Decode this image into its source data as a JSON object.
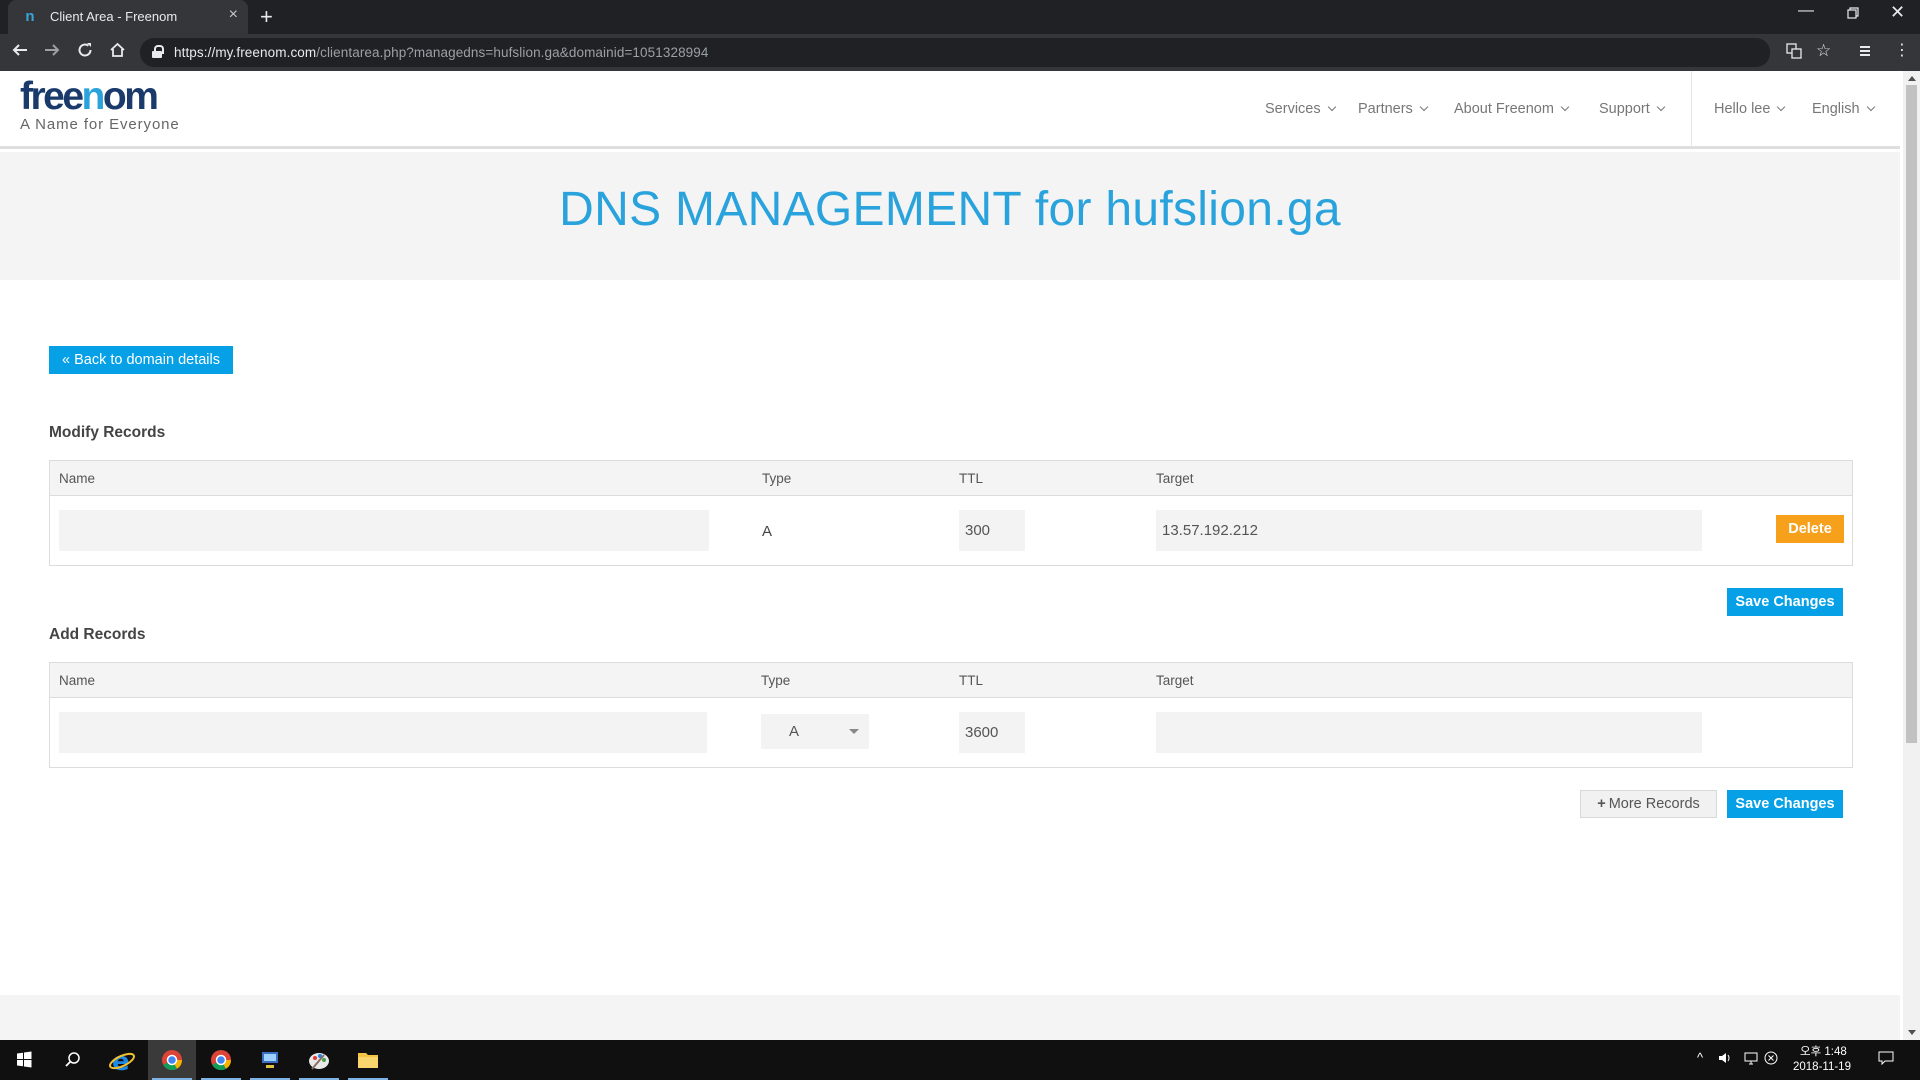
{
  "browser": {
    "tab_title": "Client Area - Freenom",
    "favicon_letter": "n",
    "url_host": "https://my.freenom.com",
    "url_path": "/clientarea.php?managedns=hufslion.ga&domainid=1051328994"
  },
  "header": {
    "logo_free": "free",
    "logo_n": "n",
    "logo_om": "om",
    "tagline": "A Name for Everyone",
    "nav": [
      "Services",
      "Partners",
      "About Freenom",
      "Support"
    ],
    "user": "Hello lee",
    "language": "English"
  },
  "page": {
    "title": "DNS MANAGEMENT for hufslion.ga",
    "back_button": "« Back to domain details"
  },
  "modify": {
    "section_title": "Modify Records",
    "headers": {
      "name": "Name",
      "type": "Type",
      "ttl": "TTL",
      "target": "Target"
    },
    "record": {
      "name": "",
      "type": "A",
      "ttl": "300",
      "target": "13.57.192.212"
    },
    "delete_label": "Delete",
    "save_label": "Save Changes"
  },
  "add": {
    "section_title": "Add Records",
    "headers": {
      "name": "Name",
      "type": "Type",
      "ttl": "TTL",
      "target": "Target"
    },
    "record": {
      "name": "",
      "type": "A",
      "ttl": "3600",
      "target": ""
    },
    "more_label": "More Records",
    "save_label": "Save Changes"
  },
  "taskbar": {
    "time_ampm": "오후 1:48",
    "date": "2018-11-19"
  },
  "colors": {
    "accent": "#05a0e6",
    "title_blue": "#2aa3dd",
    "delete_orange": "#f6a01b",
    "logo_navy": "#1a3a6b"
  }
}
